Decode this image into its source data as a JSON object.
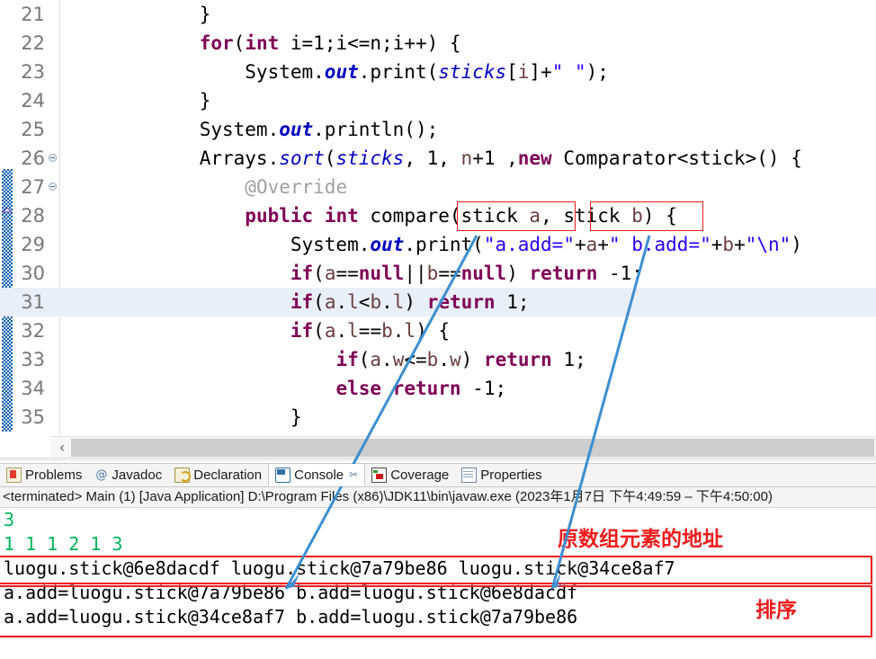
{
  "editor": {
    "first_line_number": 21,
    "highlighted_line": 31,
    "lines": [
      {
        "n": 21,
        "fold": false,
        "tokens": [
          {
            "t": "            }",
            "c": "plain"
          }
        ]
      },
      {
        "n": 22,
        "fold": false,
        "tokens": [
          {
            "t": "            ",
            "c": "plain"
          },
          {
            "t": "for",
            "c": "kw"
          },
          {
            "t": "(",
            "c": "plain"
          },
          {
            "t": "int",
            "c": "kw"
          },
          {
            "t": " i=1;i<=n;i++) {",
            "c": "plain"
          }
        ]
      },
      {
        "n": 23,
        "fold": false,
        "tokens": [
          {
            "t": "                System.",
            "c": "plain"
          },
          {
            "t": "out",
            "c": "stat"
          },
          {
            "t": ".print(",
            "c": "plain"
          },
          {
            "t": "sticks",
            "c": "fld"
          },
          {
            "t": "[",
            "c": "plain"
          },
          {
            "t": "i",
            "c": "fldn"
          },
          {
            "t": "]+",
            "c": "plain"
          },
          {
            "t": "\" \"",
            "c": "str"
          },
          {
            "t": ");",
            "c": "plain"
          }
        ]
      },
      {
        "n": 24,
        "fold": false,
        "tokens": [
          {
            "t": "            }",
            "c": "plain"
          }
        ]
      },
      {
        "n": 25,
        "fold": false,
        "tokens": [
          {
            "t": "            System.",
            "c": "plain"
          },
          {
            "t": "out",
            "c": "stat"
          },
          {
            "t": ".println();",
            "c": "plain"
          }
        ]
      },
      {
        "n": 26,
        "fold": true,
        "tokens": [
          {
            "t": "            Arrays.",
            "c": "plain"
          },
          {
            "t": "sort",
            "c": "fld"
          },
          {
            "t": "(",
            "c": "plain"
          },
          {
            "t": "sticks",
            "c": "fld"
          },
          {
            "t": ", 1, ",
            "c": "plain"
          },
          {
            "t": "n",
            "c": "fldn"
          },
          {
            "t": "+1 ,",
            "c": "plain"
          },
          {
            "t": "new",
            "c": "kw"
          },
          {
            "t": " Comparator<stick>() {",
            "c": "plain"
          }
        ]
      },
      {
        "n": 27,
        "fold": true,
        "tokens": [
          {
            "t": "                ",
            "c": "plain"
          },
          {
            "t": "@Override",
            "c": "ann"
          }
        ]
      },
      {
        "n": 28,
        "fold": false,
        "tokens": [
          {
            "t": "                ",
            "c": "plain"
          },
          {
            "t": "public",
            "c": "kw"
          },
          {
            "t": " ",
            "c": "plain"
          },
          {
            "t": "int",
            "c": "kw"
          },
          {
            "t": " compare(stick ",
            "c": "plain"
          },
          {
            "t": "a",
            "c": "fldn"
          },
          {
            "t": ", stick ",
            "c": "plain"
          },
          {
            "t": "b",
            "c": "fldn"
          },
          {
            "t": ") {",
            "c": "plain"
          }
        ]
      },
      {
        "n": 29,
        "fold": false,
        "tokens": [
          {
            "t": "                    System.",
            "c": "plain"
          },
          {
            "t": "out",
            "c": "stat"
          },
          {
            "t": ".print(",
            "c": "plain"
          },
          {
            "t": "\"a.add=\"",
            "c": "str"
          },
          {
            "t": "+",
            "c": "plain"
          },
          {
            "t": "a",
            "c": "fldn"
          },
          {
            "t": "+",
            "c": "plain"
          },
          {
            "t": "\" b.add=\"",
            "c": "str"
          },
          {
            "t": "+",
            "c": "plain"
          },
          {
            "t": "b",
            "c": "fldn"
          },
          {
            "t": "+",
            "c": "plain"
          },
          {
            "t": "\"\\n\"",
            "c": "str"
          },
          {
            "t": ")",
            "c": "plain"
          }
        ]
      },
      {
        "n": 30,
        "fold": false,
        "tokens": [
          {
            "t": "                    ",
            "c": "plain"
          },
          {
            "t": "if",
            "c": "kw"
          },
          {
            "t": "(",
            "c": "plain"
          },
          {
            "t": "a",
            "c": "fldn"
          },
          {
            "t": "==",
            "c": "plain"
          },
          {
            "t": "null",
            "c": "kw"
          },
          {
            "t": "||",
            "c": "plain"
          },
          {
            "t": "b",
            "c": "fldn"
          },
          {
            "t": "==",
            "c": "plain"
          },
          {
            "t": "null",
            "c": "kw"
          },
          {
            "t": ") ",
            "c": "plain"
          },
          {
            "t": "return",
            "c": "kw"
          },
          {
            "t": " -1;",
            "c": "plain"
          }
        ]
      },
      {
        "n": 31,
        "fold": false,
        "tokens": [
          {
            "t": "                    ",
            "c": "plain"
          },
          {
            "t": "if",
            "c": "kw"
          },
          {
            "t": "(",
            "c": "plain"
          },
          {
            "t": "a",
            "c": "fldn"
          },
          {
            "t": ".",
            "c": "plain"
          },
          {
            "t": "l",
            "c": "fldn"
          },
          {
            "t": "<",
            "c": "plain"
          },
          {
            "t": "b",
            "c": "fldn"
          },
          {
            "t": ".",
            "c": "plain"
          },
          {
            "t": "l",
            "c": "fldn"
          },
          {
            "t": ") ",
            "c": "plain"
          },
          {
            "t": "return",
            "c": "kw"
          },
          {
            "t": " 1;",
            "c": "plain"
          }
        ]
      },
      {
        "n": 32,
        "fold": false,
        "tokens": [
          {
            "t": "                    ",
            "c": "plain"
          },
          {
            "t": "if",
            "c": "kw"
          },
          {
            "t": "(",
            "c": "plain"
          },
          {
            "t": "a",
            "c": "fldn"
          },
          {
            "t": ".",
            "c": "plain"
          },
          {
            "t": "l",
            "c": "fldn"
          },
          {
            "t": "==",
            "c": "plain"
          },
          {
            "t": "b",
            "c": "fldn"
          },
          {
            "t": ".",
            "c": "plain"
          },
          {
            "t": "l",
            "c": "fldn"
          },
          {
            "t": ") {",
            "c": "plain"
          }
        ]
      },
      {
        "n": 33,
        "fold": false,
        "tokens": [
          {
            "t": "                        ",
            "c": "plain"
          },
          {
            "t": "if",
            "c": "kw"
          },
          {
            "t": "(",
            "c": "plain"
          },
          {
            "t": "a",
            "c": "fldn"
          },
          {
            "t": ".",
            "c": "plain"
          },
          {
            "t": "w",
            "c": "fldn"
          },
          {
            "t": "<=",
            "c": "plain"
          },
          {
            "t": "b",
            "c": "fldn"
          },
          {
            "t": ".",
            "c": "plain"
          },
          {
            "t": "w",
            "c": "fldn"
          },
          {
            "t": ") ",
            "c": "plain"
          },
          {
            "t": "return",
            "c": "kw"
          },
          {
            "t": " 1;",
            "c": "plain"
          }
        ]
      },
      {
        "n": 34,
        "fold": false,
        "tokens": [
          {
            "t": "                        ",
            "c": "plain"
          },
          {
            "t": "else",
            "c": "kw"
          },
          {
            "t": " ",
            "c": "plain"
          },
          {
            "t": "return",
            "c": "kw"
          },
          {
            "t": " -1;",
            "c": "plain"
          }
        ]
      },
      {
        "n": 35,
        "fold": false,
        "tokens": [
          {
            "t": "                    }",
            "c": "plain"
          }
        ]
      }
    ],
    "scrollbar_left_arrow": "‹"
  },
  "panel": {
    "tabs": [
      {
        "label": "Problems",
        "icon": "problems-icon",
        "active": false,
        "pinned": false
      },
      {
        "label": "Javadoc",
        "icon": "javadoc-icon",
        "active": false,
        "pinned": false
      },
      {
        "label": "Declaration",
        "icon": "declaration-icon",
        "active": false,
        "pinned": false
      },
      {
        "label": "Console",
        "icon": "console-icon",
        "active": true,
        "pinned": true
      },
      {
        "label": "Coverage",
        "icon": "coverage-icon",
        "active": false,
        "pinned": false
      },
      {
        "label": "Properties",
        "icon": "properties-icon",
        "active": false,
        "pinned": false
      }
    ],
    "launch_status": "<terminated> Main (1) [Java Application] D:\\Program Files (x86)\\JDK11\\bin\\javaw.exe  (2023年1月7日 下午4:49:59 – 下午4:50:00)",
    "output": [
      {
        "text": "3",
        "color": "green"
      },
      {
        "text": "1 1 1 2 1 3",
        "color": "green"
      },
      {
        "text": "luogu.stick@6e8dacdf luogu.stick@7a79be86 luogu.stick@34ce8af7",
        "color": "black"
      },
      {
        "text": "a.add=luogu.stick@7a79be86 b.add=luogu.stick@6e8dacdf",
        "color": "black"
      },
      {
        "text": "a.add=luogu.stick@34ce8af7 b.add=luogu.stick@7a79be86",
        "color": "black"
      }
    ]
  },
  "annotations": {
    "note_addresses": "原数组元素的地址",
    "note_sort": "排序",
    "accent_red": "#ee1c1c",
    "accent_blue": "#3d8fd1"
  }
}
